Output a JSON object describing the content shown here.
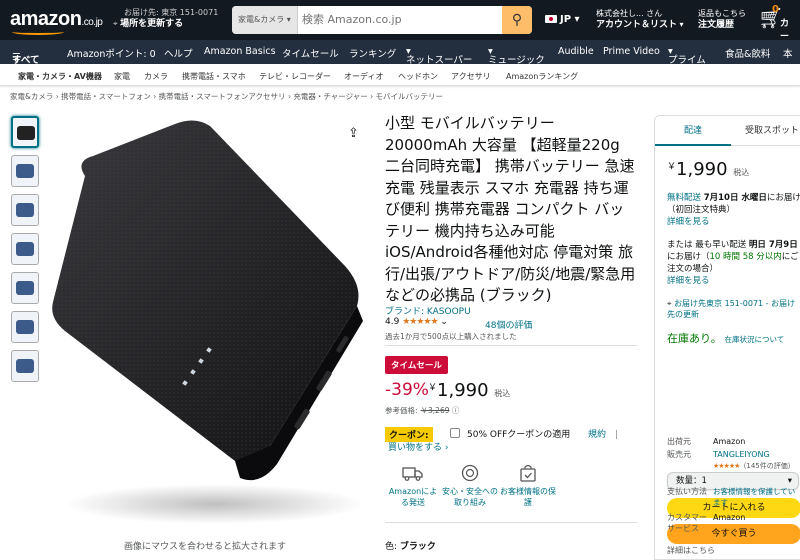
{
  "header": {
    "logo": "amazon",
    "logo_tld": ".co.jp",
    "deliver_line1": "お届け先: 東京 151-0071",
    "deliver_line2": "場所を更新する",
    "search_category": "家電&カメラ",
    "search_placeholder": "検索 Amazon.co.jp",
    "language": "JP",
    "account_line1": "株式会社し... さん",
    "account_line2": "アカウント＆リスト",
    "orders_line1": "返品もこちら",
    "orders_line2": "注文履歴",
    "cart_count": "0",
    "cart_label": "カート"
  },
  "nav": [
    "すべて",
    "Amazonポイント: 0",
    "ヘルプ",
    "Amazon Basics",
    "タイムセール",
    "ランキング",
    "ネットスーパー",
    "ミュージック",
    "Audible",
    "Prime Video",
    "プライム",
    "食品&飲料",
    "本"
  ],
  "subnav": [
    "家電・カメラ・AV機器",
    "家電",
    "カメラ",
    "携帯電話・スマホ",
    "テレビ・レコーダー",
    "オーディオ",
    "ヘッドホン",
    "アクセサリ",
    "Amazonランキング"
  ],
  "breadcrumb": "家電&カメラ › 携帯電話・スマートフォン › 携帯電話・スマートフォンアクセサリ › 充電器・チャージャー › モバイルバッテリー",
  "image_caption": "画像にマウスを合わせると拡大されます",
  "product": {
    "title": "小型 モバイルバッテリー 20000mAh 大容量 【超軽量220g 二台同時充電】 携帯バッテリー 急速充電 残量表示 スマホ 充電器 持ち運び便利 携帯充電器 コンパクト バッテリー 機内持ち込み可能 iOS/Android各種他対応 停電対策 旅行/出張/アウトドア/防災/地震/緊急用などの必携品 (ブラック)",
    "brand": "ブランド: KASOOPU",
    "rating": "4.9",
    "stars": "★★★★★",
    "reviews": "48個の評価",
    "bought": "過去1か月で500点以上購入されました",
    "sale_badge": "タイムセール",
    "discount": "-39%",
    "price_symbol": "￥",
    "price": "1,990",
    "tax": "税込",
    "ref_label": "参考価格:",
    "ref_price": "￥3,269",
    "coupon_label": "クーポン:",
    "coupon_text": "50% OFFクーポンの適用",
    "coupon_terms": "規約",
    "coupon_sep": "|",
    "coupon_more": "買い物をする",
    "features": [
      {
        "icon": "delivery-truck-icon",
        "label": "Amazonによる発送"
      },
      {
        "icon": "safety-badge-icon",
        "label": "安心・安全への取り組み"
      },
      {
        "icon": "secure-bag-icon",
        "label": "お客様情報の保護"
      }
    ],
    "color_label": "色:",
    "color_value": "ブラック"
  },
  "buybox": {
    "tab_delivery": "配達",
    "tab_pickup": "受取スポット",
    "price_symbol": "￥",
    "price": "1,990",
    "tax": "税込",
    "free_delivery": "無料配送",
    "delivery_date": "7月10日 水曜日",
    "delivery_suffix": "にお届け（初回注文特典）",
    "details": "詳細を見る",
    "fastest_prefix": "または 最も早い配送",
    "fastest_date": "明日 7月9日",
    "fastest_mid": "にお届け（",
    "fastest_cutoff": "10 時間 58 分以内",
    "fastest_suffix": "にご注文の場合）",
    "details2": "詳細を見る",
    "location": "お届け先東京 151-0071 - お届け先の更新",
    "stock": "在庫あり。",
    "stock_status": "在庫状況について",
    "quantity": "数量：1",
    "add_to_cart": "カートに入れる",
    "buy_now": "今すぐ買う",
    "shipper_label": "出荷元",
    "shipper": "Amazon",
    "seller_label": "販売元",
    "seller": "TANGLEIYONG",
    "seller_stars": "★★★★★",
    "seller_ratings": "（145件の評価）",
    "payment_label": "支払い方法",
    "payment": "お客様情報を保護しています",
    "cs_label": "カスタマーサービス",
    "cs": "Amazon",
    "more": "詳細はこちら"
  },
  "colors": {
    "header_bg": "#131921",
    "nav_bg": "#232f3e",
    "search_button": "#febd69",
    "link": "#007185",
    "sale_red": "#cc0c39",
    "cart_button": "#ffd814",
    "buy_button": "#ffa41c",
    "star": "#de7921"
  }
}
